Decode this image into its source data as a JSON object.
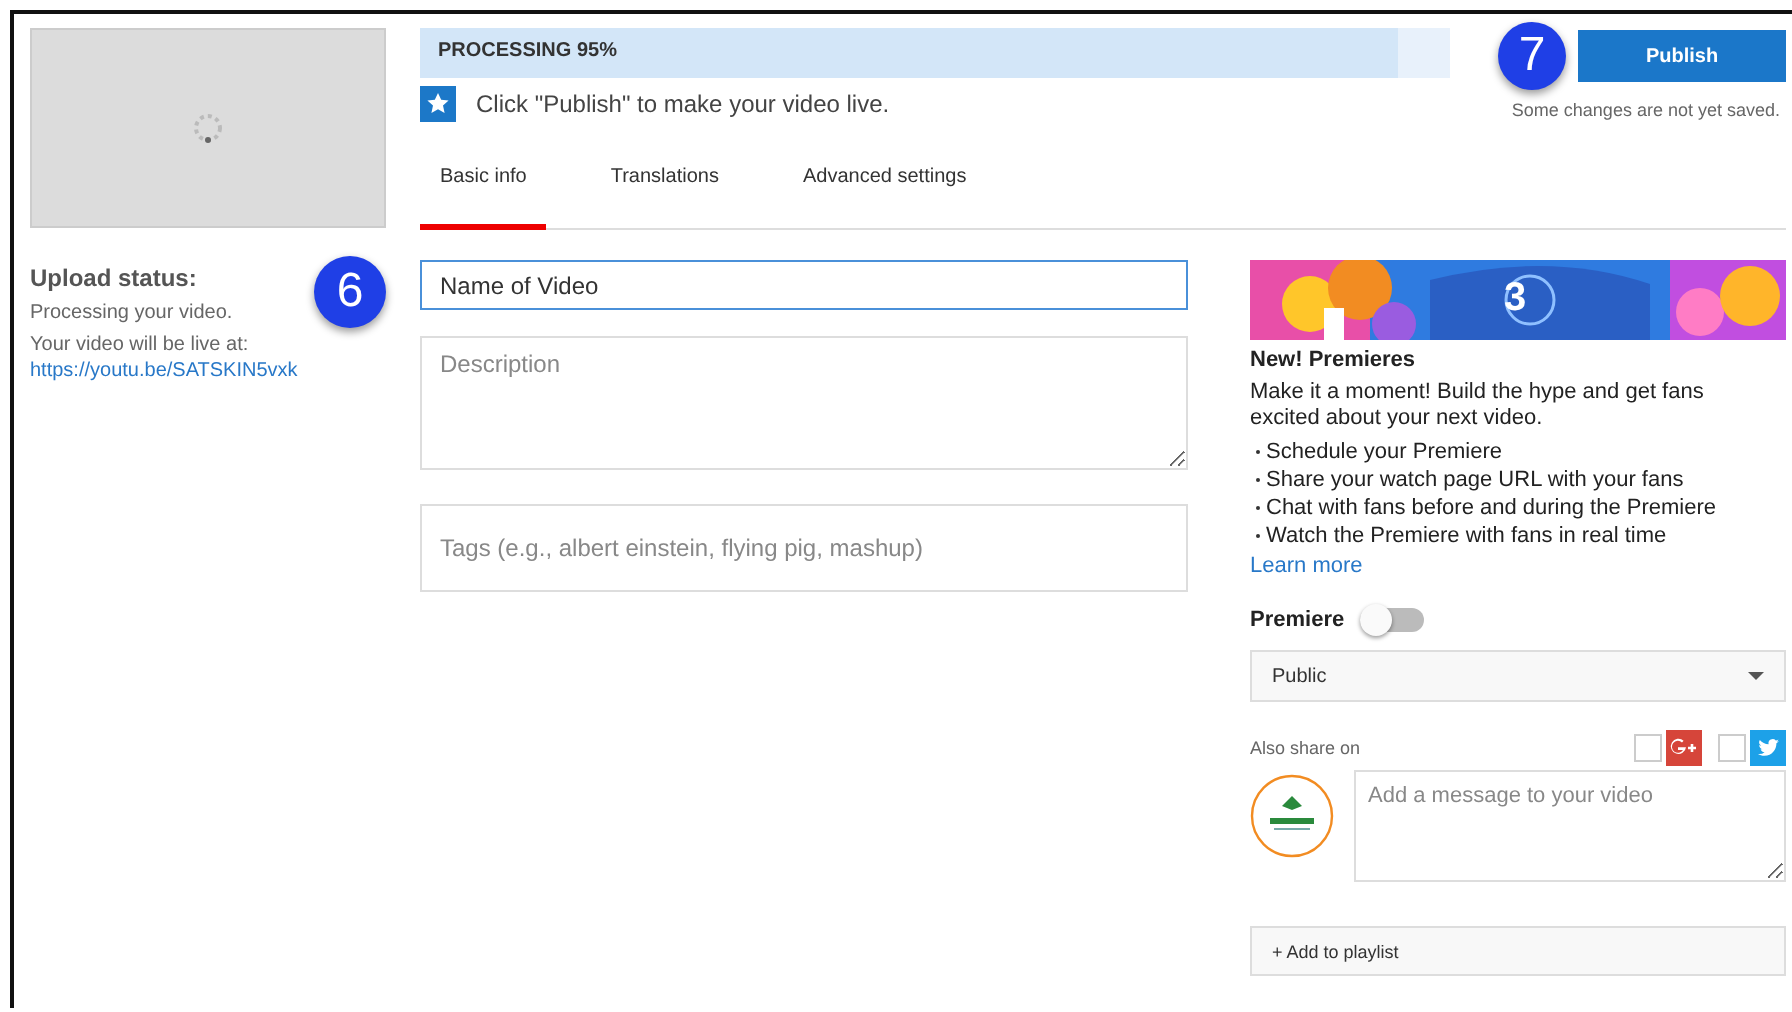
{
  "thumbnail": {
    "kind": "picture"
  },
  "upload_status": {
    "title": "Upload status:",
    "message": "Processing your video.",
    "live_label": "Your video will be live at:",
    "link": "https://youtu.be/SATSKIN5vxk"
  },
  "progress": {
    "label": "PROCESSING 95%",
    "level": 0.95
  },
  "publish_button": "Publish",
  "save_note": "Some changes are not yet saved.",
  "hint": "Click \"Publish\" to make your video live.",
  "tabs": [
    {
      "label": "Basic info",
      "selected": true
    },
    {
      "label": "Translations",
      "selected": false
    },
    {
      "label": "Advanced settings",
      "selected": false
    }
  ],
  "title_field": {
    "value": "Name of Video"
  },
  "description_field": {
    "placeholder": "Description"
  },
  "tags_field": {
    "placeholder": "Tags (e.g., albert einstein, flying pig, mashup)"
  },
  "premieres": {
    "title": "New! Premieres",
    "intro": "Make it a moment! Build the hype and get fans excited about your next video.",
    "bullets": [
      "Schedule your Premiere",
      "Share your watch page URL with your fans",
      "Chat with fans before and during the Premiere",
      "Watch the Premiere with fans in real time"
    ],
    "link": "Learn more",
    "banner_number": "3"
  },
  "premiere_toggle": {
    "label": "Premiere",
    "on": false
  },
  "visibility": "Public",
  "share": {
    "label": "Also share on",
    "networks": [
      {
        "kind": "gplus",
        "checked": false
      },
      {
        "kind": "twitter",
        "checked": false
      }
    ]
  },
  "message_field": {
    "placeholder": "Add a message to your video"
  },
  "playlist_button": "+ Add to playlist",
  "annotations": [
    "6",
    "7"
  ]
}
